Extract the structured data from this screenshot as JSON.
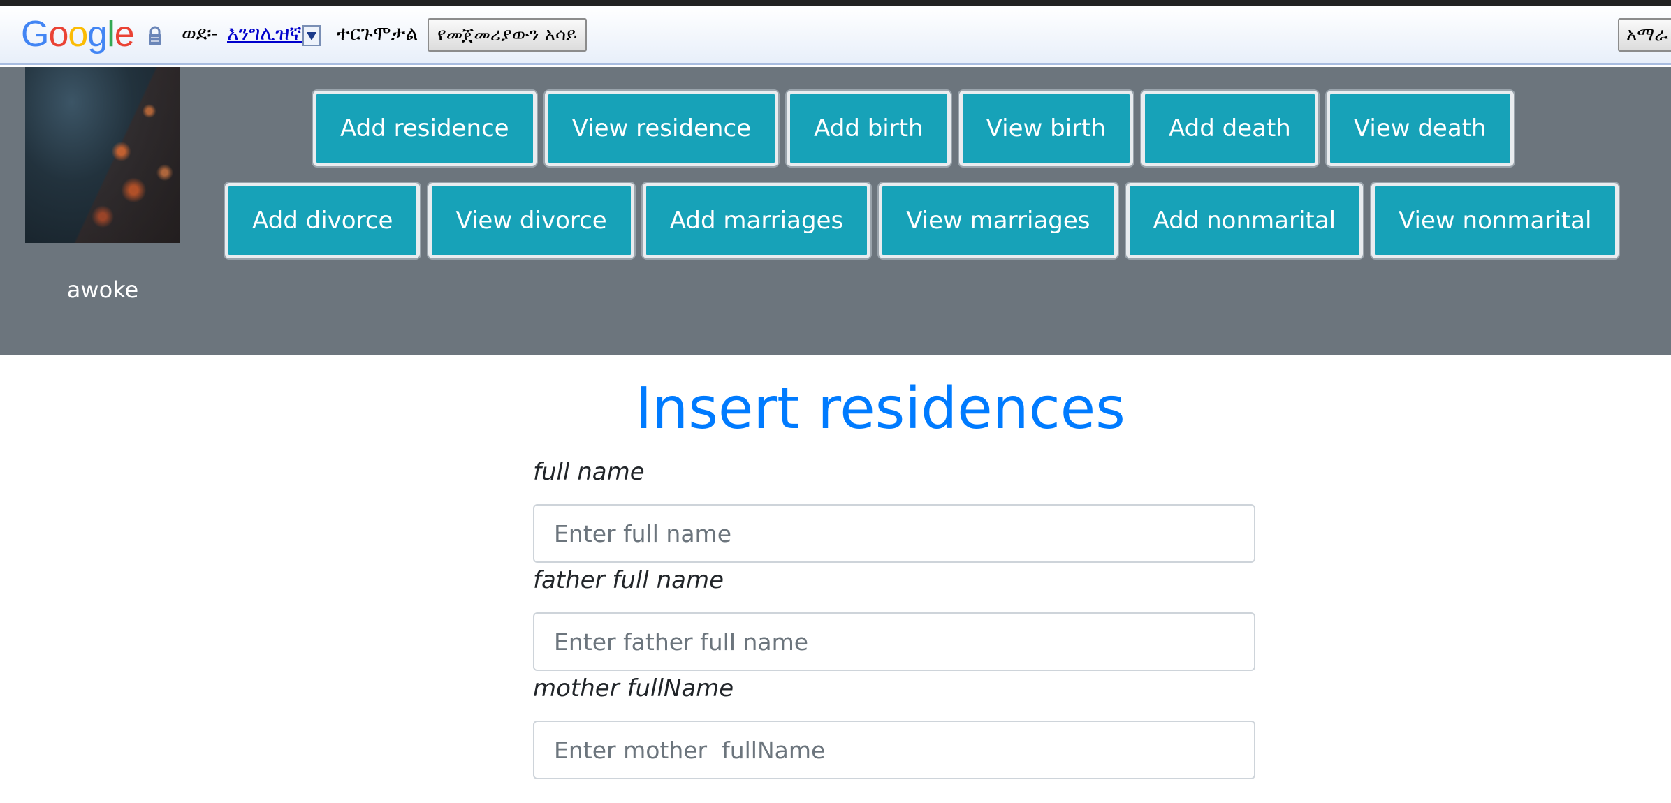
{
  "translate_bar": {
    "logo": {
      "g1": "G",
      "o1": "o",
      "o2": "o",
      "g2": "g",
      "l": "l",
      "e": "e"
    },
    "to_label": "ወደ፡-",
    "language_link": "እንግሊዝኛ",
    "status": "ተርጉሞታል",
    "show_original_label": "የመጀመሪያውን አሳይ",
    "language_button_label": "አማራ"
  },
  "header": {
    "username": "awoke",
    "nav_row_1": [
      "Add residence",
      "View residence",
      "Add birth",
      "View birth",
      "Add death",
      "View death"
    ],
    "nav_row_2": [
      "Add divorce",
      "View divorce",
      "Add marriages",
      "View marriages",
      "Add nonmarital",
      "View nonmarital"
    ]
  },
  "form": {
    "title": "Insert residences",
    "fields": [
      {
        "label": "full name",
        "placeholder": "Enter full name",
        "value": ""
      },
      {
        "label": "father full name",
        "placeholder": "Enter father full name",
        "value": ""
      },
      {
        "label": "mother fullName",
        "placeholder": "Enter mother  fullName",
        "value": ""
      }
    ]
  },
  "colors": {
    "header_bg": "#6c757d",
    "nav_button": "#17a2b8",
    "title": "#007bff"
  }
}
